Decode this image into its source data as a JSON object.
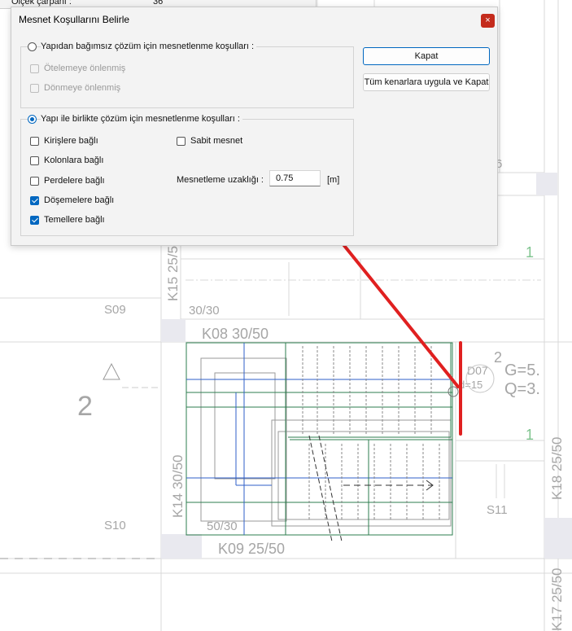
{
  "underlying": {
    "label": "Ölçek çarpanı :",
    "value": "36"
  },
  "dialog": {
    "title": "Mesnet Koşullarını Belirle",
    "close_glyph": "×",
    "group1": {
      "radio_label": "Yapıdan bağımsız çözüm için mesnetlenme koşulları  :",
      "selected": false,
      "options": [
        {
          "label": "Ötelemeye önlenmiş",
          "checked": false,
          "disabled": true
        },
        {
          "label": "Dönmeye önlenmiş",
          "checked": false,
          "disabled": true
        }
      ]
    },
    "group2": {
      "radio_label": "Yapı ile birlikte çözüm için mesnetlenme koşulları  :",
      "selected": true,
      "kirislere": "Kirişlere bağlı",
      "kolonlara": "Kolonlara bağlı",
      "perdelere": "Perdelere bağlı",
      "dosemelere": "Döşemelere bağlı",
      "temellere": "Temellere bağlı",
      "sabit": "Sabit mesnet",
      "distance_label": "Mesnetleme uzaklığı  :",
      "distance_value": "0.75",
      "distance_unit": "[m]"
    },
    "buttons": {
      "close": "Kapat",
      "apply_all": "Tüm kenarlara uygula ve Kapat"
    }
  },
  "drawing": {
    "labels": {
      "s09": "S09",
      "s10": "S10",
      "s11": "S11",
      "k08": "K08 30/50",
      "k09": "K09 25/50",
      "k14": "K14 30/50",
      "k15": "K15 25/50",
      "k18": "K18 25/50",
      "k17": "K17 25/50",
      "beam3030": "30/30",
      "beam5030": "50/30",
      "d07": "D07",
      "d07h": "d=15",
      "g": "G=5.",
      "q": "Q=3.",
      "two_big": "2",
      "two_small": "2",
      "one_a": "1",
      "one_b": "1",
      "six": "6"
    },
    "colors": {
      "grid": "#d9d9d9",
      "beam": "#9a9a9a",
      "stair_green": "#2e7d4f",
      "stair_blue": "#2f5fc8",
      "annotation_red": "#e02020"
    }
  }
}
